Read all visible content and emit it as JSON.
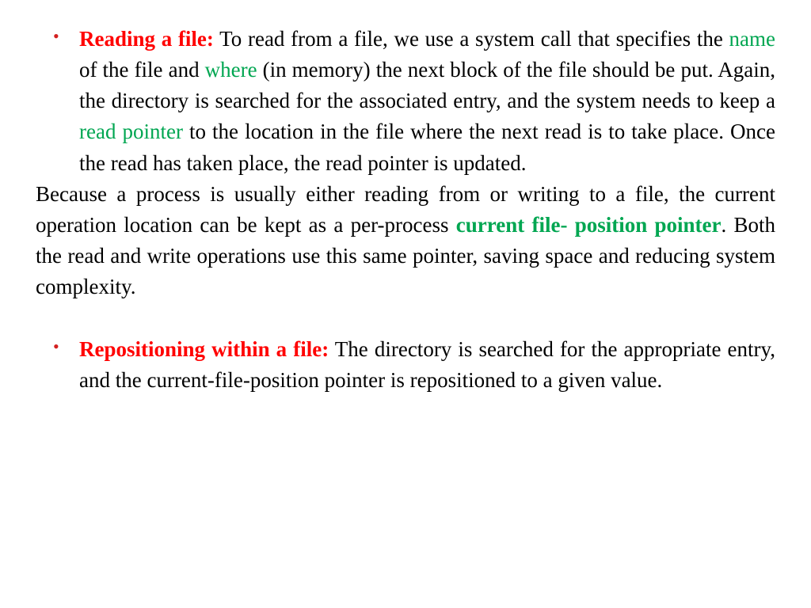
{
  "item1": {
    "heading": "Reading a file:",
    "t1": " To read from a file, we use a system call that specifies the ",
    "g1": "name",
    "t2": " of the file and ",
    "g2": "where",
    "t3": " (in memory) the next block of the file should be put. Again, the directory is searched for the associated entry, and the system needs to keep a ",
    "g3": "read pointer",
    "t4": " to the location in the file where the next read is to take place. Once the read has taken place, the read pointer is updated."
  },
  "para": {
    "t1": "Because a process is usually either reading from or writing to a file, the current operation location can be kept as a per-process ",
    "g1": "current file- position pointer",
    "t2": ". Both the read and write operations use this same pointer, saving space and reducing system complexity."
  },
  "item2": {
    "heading": "Repositioning within a file:",
    "t1": " The directory is searched for the appropriate entry, and the current-file-position pointer is repositioned to a given value."
  }
}
